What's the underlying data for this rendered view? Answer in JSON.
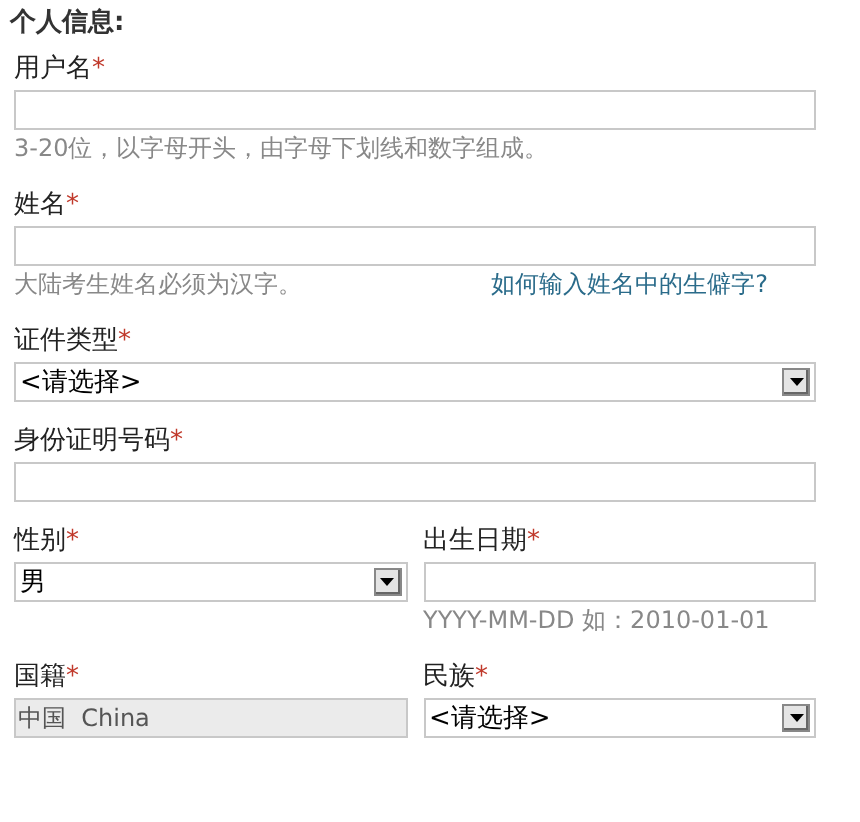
{
  "heading": "个人信息:",
  "rows": [
    [
      {
        "kind": "text",
        "label": "用户名",
        "mark": "*",
        "hint": "3-20位，以字母开头，由字母下划线和数字组成。"
      }
    ],
    [
      {
        "kind": "text",
        "label": "姓名",
        "mark": "*",
        "hint": "大陆考生姓名必须为汉字。",
        "link": "如何输入姓名中的生僻字?"
      }
    ],
    [
      {
        "kind": "select",
        "label": "证件类型",
        "mark": "*",
        "value": "<请选择>"
      }
    ],
    [
      {
        "kind": "text",
        "label": "身份证明号码",
        "mark": "*"
      }
    ],
    [
      {
        "kind": "select",
        "label": "性别",
        "mark": "*",
        "value": "男"
      },
      {
        "kind": "text",
        "label": "出生日期",
        "mark": "*",
        "hint": "YYYY-MM-DD 如：2010-01-01"
      }
    ],
    [
      {
        "kind": "readonly",
        "label": "国籍",
        "mark": "*",
        "value": "中国  China"
      },
      {
        "kind": "select",
        "label": "民族",
        "mark": "*",
        "value": "<请选择>"
      }
    ]
  ]
}
